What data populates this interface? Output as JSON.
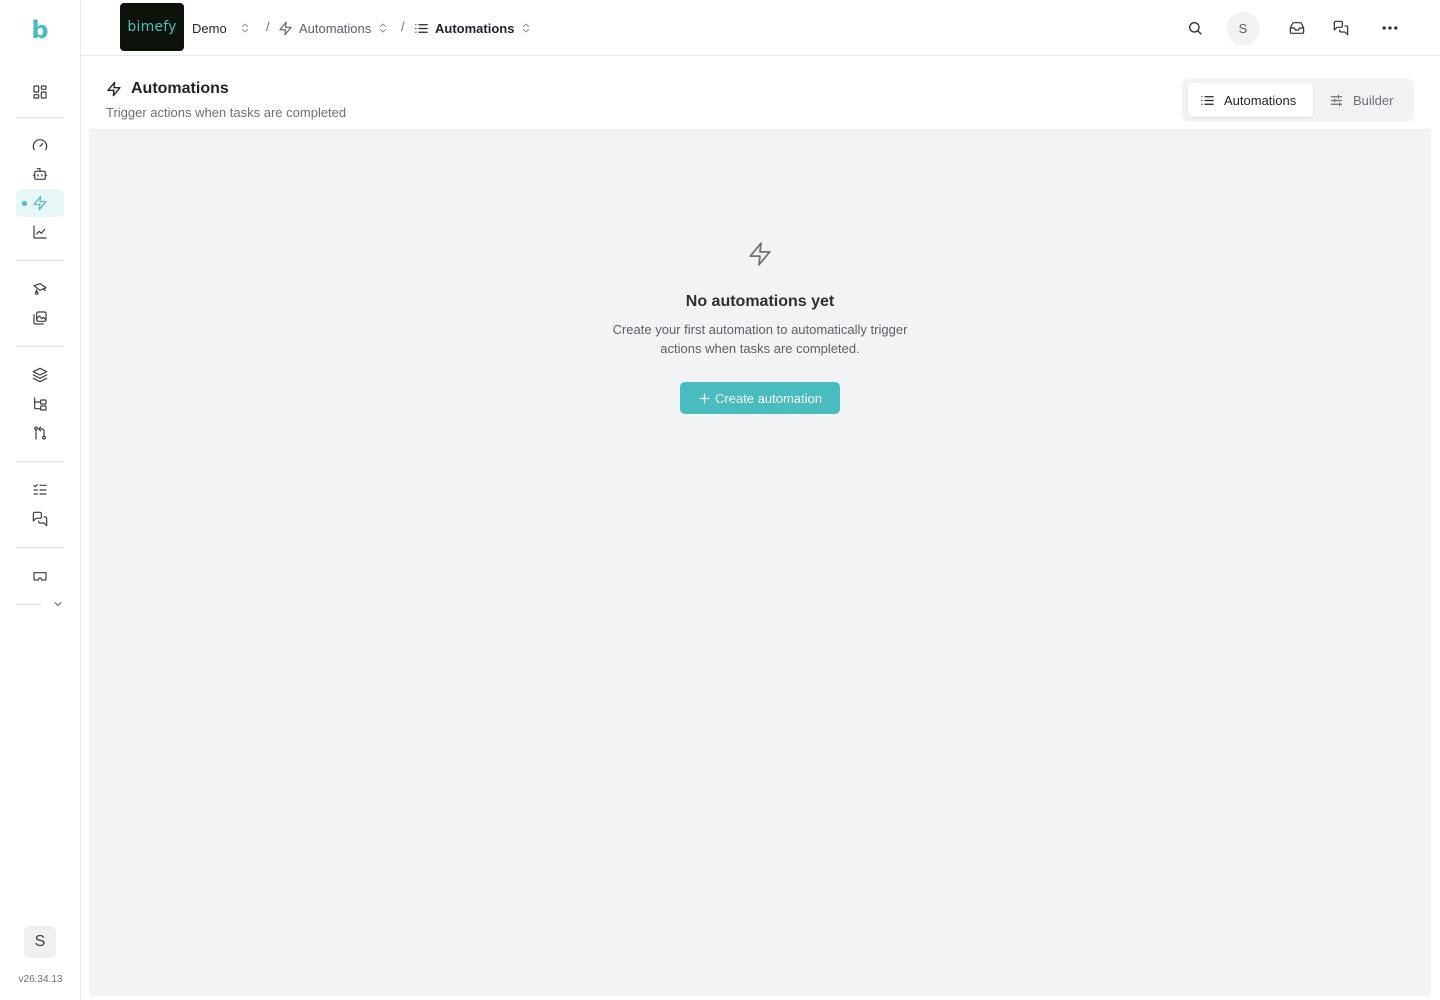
{
  "app": {
    "logo_letter": "b",
    "brand_logo_text": "bimefy",
    "version": "v26.34.13",
    "accent_color": "#49bcc0"
  },
  "sidebar": {
    "user_initial": "S",
    "active_item": "automations-icon",
    "icons": [
      "dashboard-icon",
      "gauge-icon",
      "robot-icon",
      "automations-icon",
      "chart-icon",
      "truck-icon",
      "images-icon",
      "layers-icon",
      "hierarchy-icon",
      "merge-icon",
      "checklist-icon",
      "messages-icon",
      "cardboard-icon",
      "chevron-down-icon"
    ]
  },
  "topbar": {
    "breadcrumbs": [
      {
        "label": "Demo"
      },
      {
        "label": "Automations"
      },
      {
        "label": "Automations"
      }
    ],
    "separator": "/",
    "user_initial": "S",
    "icons": [
      "search-icon",
      "inbox-icon",
      "messages-icon",
      "more-icon"
    ]
  },
  "page": {
    "title": "Automations",
    "subtitle": "Trigger actions when tasks are completed",
    "tabs": [
      {
        "label": "Automations",
        "active": true
      },
      {
        "label": "Builder",
        "active": false
      }
    ]
  },
  "empty_state": {
    "title": "No automations yet",
    "description": "Create your first automation to automatically trigger actions when tasks are completed.",
    "button_label": "Create automation"
  }
}
